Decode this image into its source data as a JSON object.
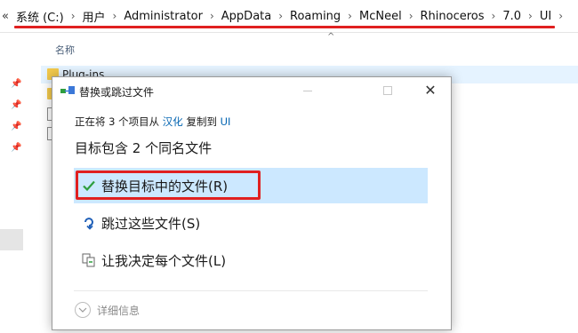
{
  "addressbar": {
    "overflow_glyph": "«",
    "crumbs": [
      "系统 (C:)",
      "用户",
      "Administrator",
      "AppData",
      "Roaming",
      "McNeel",
      "Rhinoceros",
      "7.0",
      "UI"
    ],
    "separator": "›"
  },
  "filelist": {
    "column_name": "名称",
    "sort_indicator": "^",
    "rows": [
      {
        "name": "Plug-ins",
        "kind": "folder"
      },
      {
        "name": "",
        "kind": "folder"
      },
      {
        "name": "",
        "kind": "file"
      },
      {
        "name": "",
        "kind": "file"
      }
    ]
  },
  "dialog": {
    "title": "替换或跳过文件",
    "line1_prefix": "正在将 3 个项目从 ",
    "source": "汉化",
    "line1_middle": " 复制到 ",
    "destination": "UI",
    "subheading": "目标包含 2 个同名文件",
    "options": {
      "replace": "替换目标中的文件(R)",
      "skip": "跳过这些文件(S)",
      "decide": "让我决定每个文件(L)"
    },
    "details_label": "详细信息",
    "close_glyph": "✕"
  },
  "colors": {
    "annotation_red": "#e02020",
    "option_highlight": "#cce8ff",
    "link_blue": "#0063b1",
    "check_green": "#2e9e3e"
  },
  "icons": [
    "pin-icon",
    "folder-icon",
    "file-icon",
    "copy-dialog-icon",
    "checkmark-icon",
    "skip-arrow-icon",
    "compare-files-icon",
    "chevron-down-icon",
    "close-icon"
  ]
}
